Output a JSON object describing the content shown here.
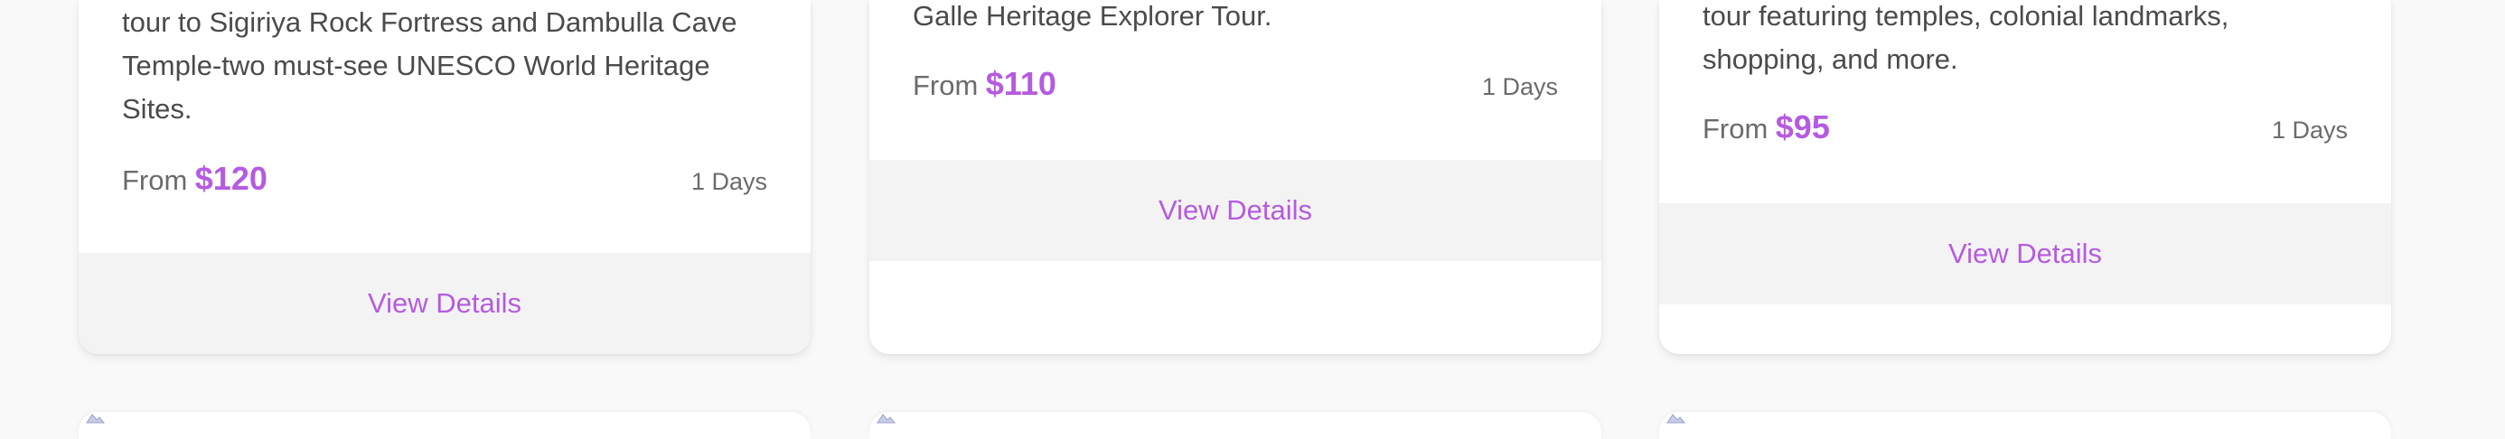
{
  "cards": [
    {
      "description_lines": [
        "tour to Sigiriya Rock Fortress and Dambulla Cave",
        "Temple-two must-see UNESCO World Heritage",
        "Sites."
      ],
      "from_label": "From",
      "price": "$120",
      "duration": "1 Days",
      "button_label": "View Details"
    },
    {
      "description_lines": [
        "Galle Heritage Explorer Tour."
      ],
      "from_label": "From",
      "price": "$110",
      "duration": "1 Days",
      "button_label": "View Details"
    },
    {
      "description_lines": [
        "tour featuring temples, colonial landmarks,",
        "shopping, and more."
      ],
      "from_label": "From",
      "price": "$95",
      "duration": "1 Days",
      "button_label": "View Details"
    }
  ],
  "colors": {
    "accent": "#b55be0",
    "page_background": "#f9f9f9",
    "footer_background": "#f3f3f3"
  },
  "next_row_icon": "broken-image-icon"
}
